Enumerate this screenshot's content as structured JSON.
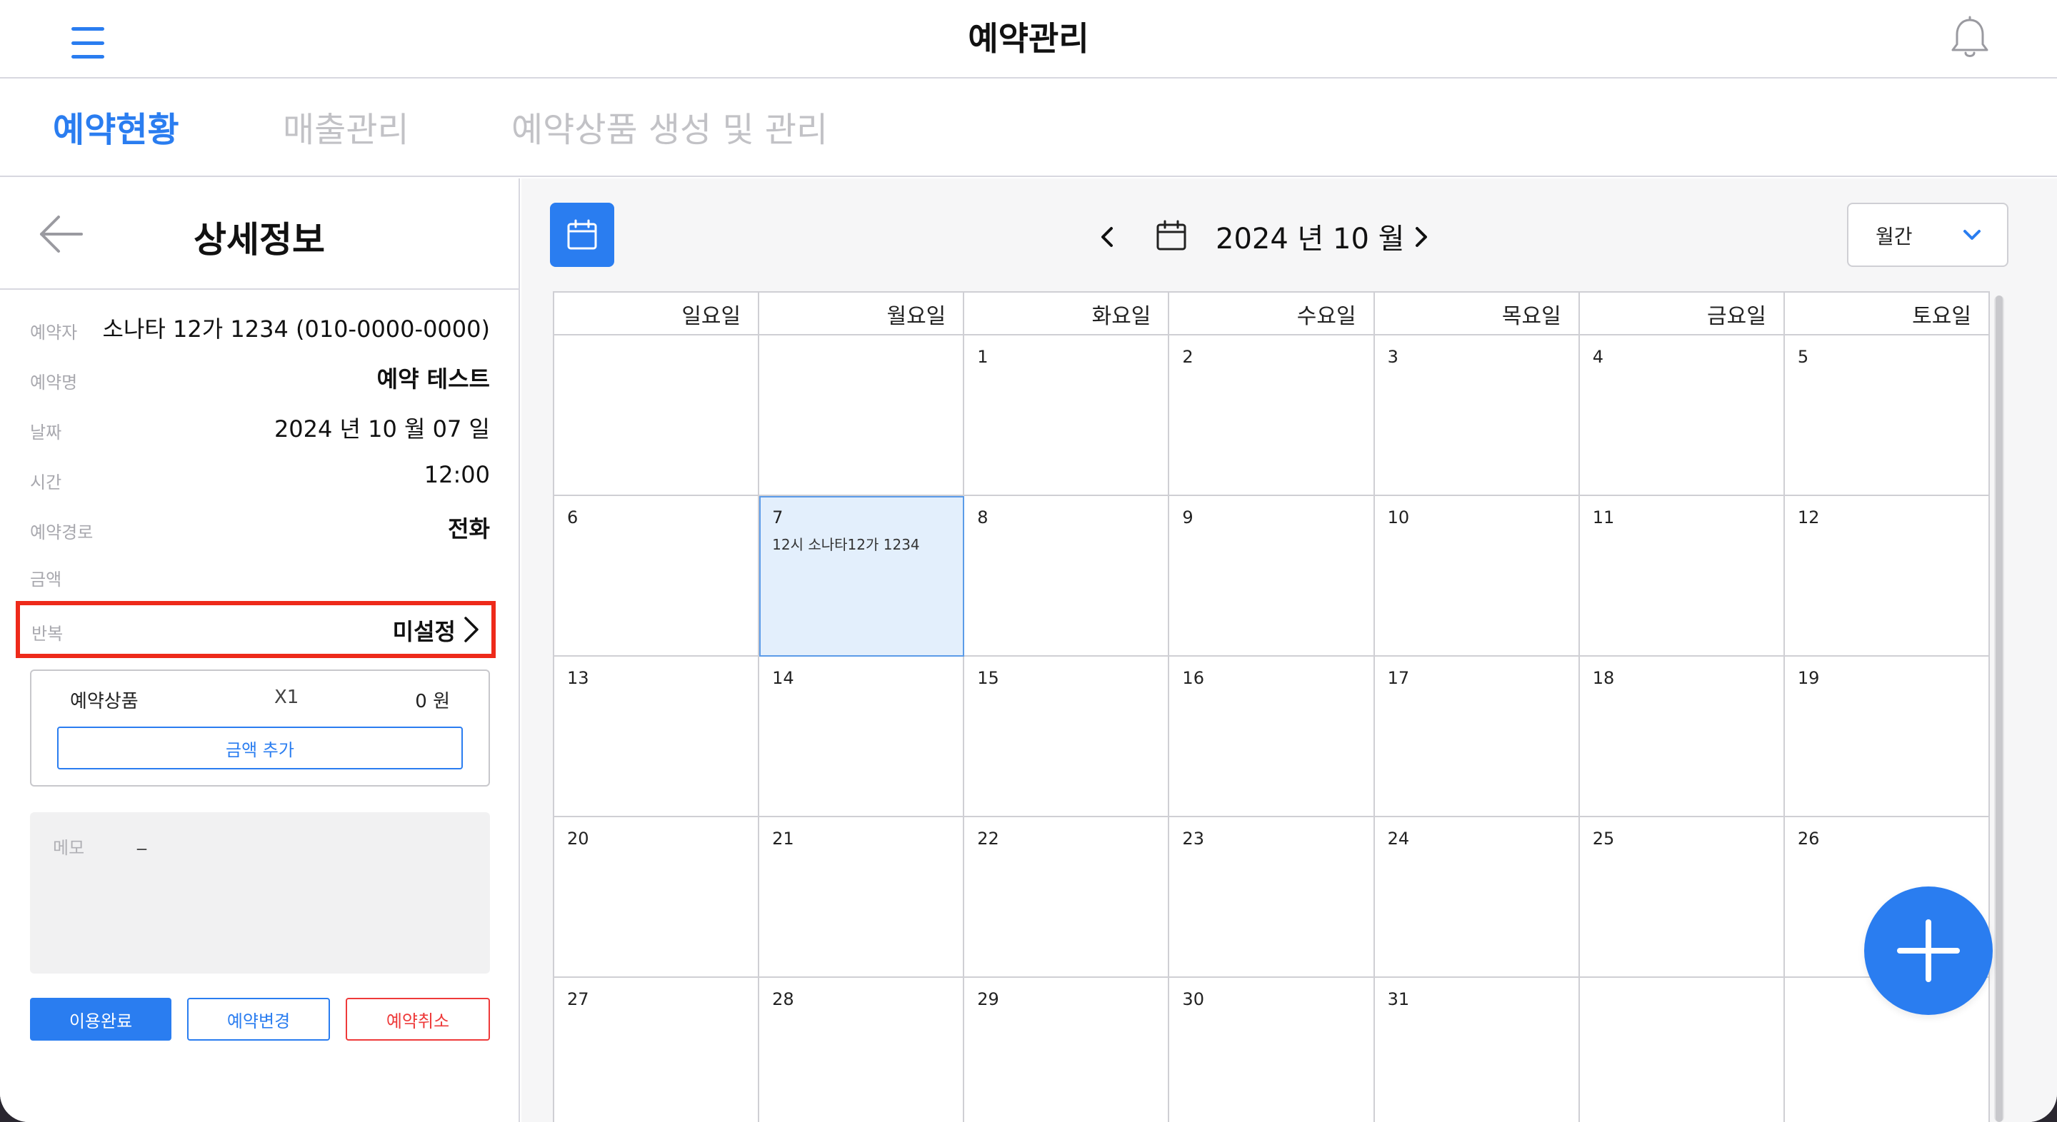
{
  "app": {
    "title": "예약관리"
  },
  "tabs": [
    {
      "label": "예약현황",
      "active": true
    },
    {
      "label": "매출관리",
      "active": false
    },
    {
      "label": "예약상품 생성 및 관리",
      "active": false
    }
  ],
  "detail": {
    "title": "상세정보",
    "fields": {
      "reserver": {
        "label": "예약자",
        "value": "소나타 12가 1234 (010-0000-0000)"
      },
      "name": {
        "label": "예약명",
        "value": "예약 테스트"
      },
      "date": {
        "label": "날짜",
        "value": "2024 년 10 월 07 일"
      },
      "time": {
        "label": "시간",
        "value": "12:00"
      },
      "route": {
        "label": "예약경로",
        "value": "전화"
      },
      "amount": {
        "label": "금액",
        "value": ""
      },
      "repeat": {
        "label": "반복",
        "value": "미설정"
      }
    },
    "product": {
      "name": "예약상품",
      "qty": "X1",
      "price": "0 원",
      "add_label": "금액 추가"
    },
    "memo": {
      "label": "메모",
      "value": "_"
    },
    "buttons": {
      "done": "이용완료",
      "change": "예약변경",
      "cancel": "예약취소"
    }
  },
  "calendar": {
    "month_label": "2024 년  10 월",
    "view": "월간",
    "weekdays": [
      "일요일",
      "월요일",
      "화요일",
      "수요일",
      "목요일",
      "금요일",
      "토요일"
    ],
    "weeks": [
      [
        "",
        "",
        "1",
        "2",
        "3",
        "4",
        "5"
      ],
      [
        "6",
        "7",
        "8",
        "9",
        "10",
        "11",
        "12"
      ],
      [
        "13",
        "14",
        "15",
        "16",
        "17",
        "18",
        "19"
      ],
      [
        "20",
        "21",
        "22",
        "23",
        "24",
        "25",
        "26"
      ],
      [
        "27",
        "28",
        "29",
        "30",
        "31",
        "",
        ""
      ]
    ],
    "selected_day": "7",
    "events": {
      "7": "12시 소나타12가 1234"
    }
  },
  "colors": {
    "accent": "#2a7df0",
    "highlight": "#ee2a1a",
    "danger": "#ee3a3a",
    "selected_bg": "#e3effc"
  },
  "icons": {
    "menu": "hamburger-menu-icon",
    "notification": "bell-icon",
    "back": "arrow-left-icon",
    "calendar": "calendar-icon",
    "prev": "chevron-left-icon",
    "next": "chevron-right-icon",
    "dropdown": "chevron-down-icon",
    "add": "plus-icon"
  }
}
